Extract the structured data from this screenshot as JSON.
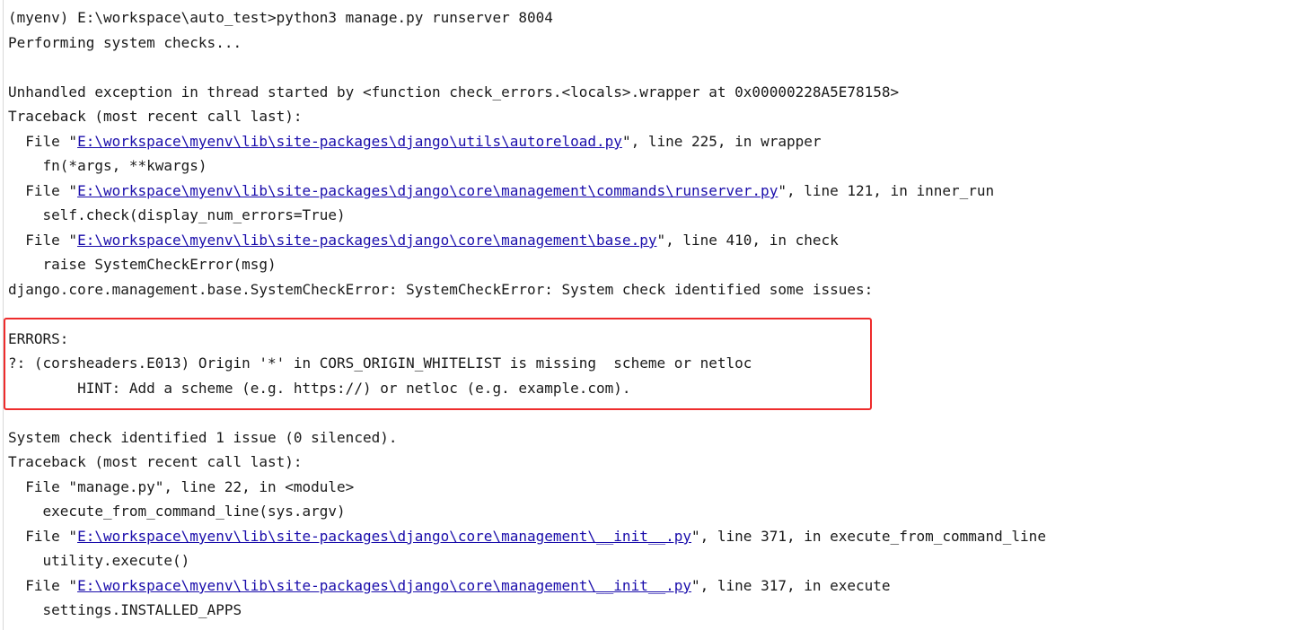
{
  "console": {
    "lines": [
      "(myenv) E:\\workspace\\auto_test>python3 manage.py runserver 8004",
      "Performing system checks...",
      "",
      "Unhandled exception in thread started by <function check_errors.<locals>.wrapper at 0x00000228A5E78158>",
      "Traceback (most recent call last):",
      "  File \"",
      "E:\\workspace\\myenv\\lib\\site-packages\\django\\utils\\autoreload.py",
      "\", line 225, in wrapper",
      "    fn(*args, **kwargs)",
      "  File \"",
      "E:\\workspace\\myenv\\lib\\site-packages\\django\\core\\management\\commands\\runserver.py",
      "\", line 121, in inner_run",
      "    self.check(display_num_errors=True)",
      "  File \"",
      "E:\\workspace\\myenv\\lib\\site-packages\\django\\core\\management\\base.py",
      "\", line 410, in check",
      "    raise SystemCheckError(msg)",
      "django.core.management.base.SystemCheckError: SystemCheckError: System check identified some issues:",
      "",
      "ERRORS:",
      "?: (corsheaders.E013) Origin '*' in CORS_ORIGIN_WHITELIST is missing  scheme or netloc",
      "        HINT: Add a scheme (e.g. https://) or netloc (e.g. example.com).",
      "",
      "System check identified 1 issue (0 silenced).",
      "Traceback (most recent call last):",
      "  File \"manage.py\", line 22, in <module>",
      "    execute_from_command_line(sys.argv)",
      "  File \"",
      "E:\\workspace\\myenv\\lib\\site-packages\\django\\core\\management\\__init__.py",
      "\", line 371, in execute_from_command_line",
      "    utility.execute()",
      "  File \"",
      "E:\\workspace\\myenv\\lib\\site-packages\\django\\core\\management\\__init__.py",
      "\", line 317, in execute",
      "    settings.INSTALLED_APPS"
    ]
  },
  "colors": {
    "text": "#1a1a1a",
    "link": "#1a0dab",
    "highlight": "#ee2c2c",
    "background": "#ffffff"
  }
}
